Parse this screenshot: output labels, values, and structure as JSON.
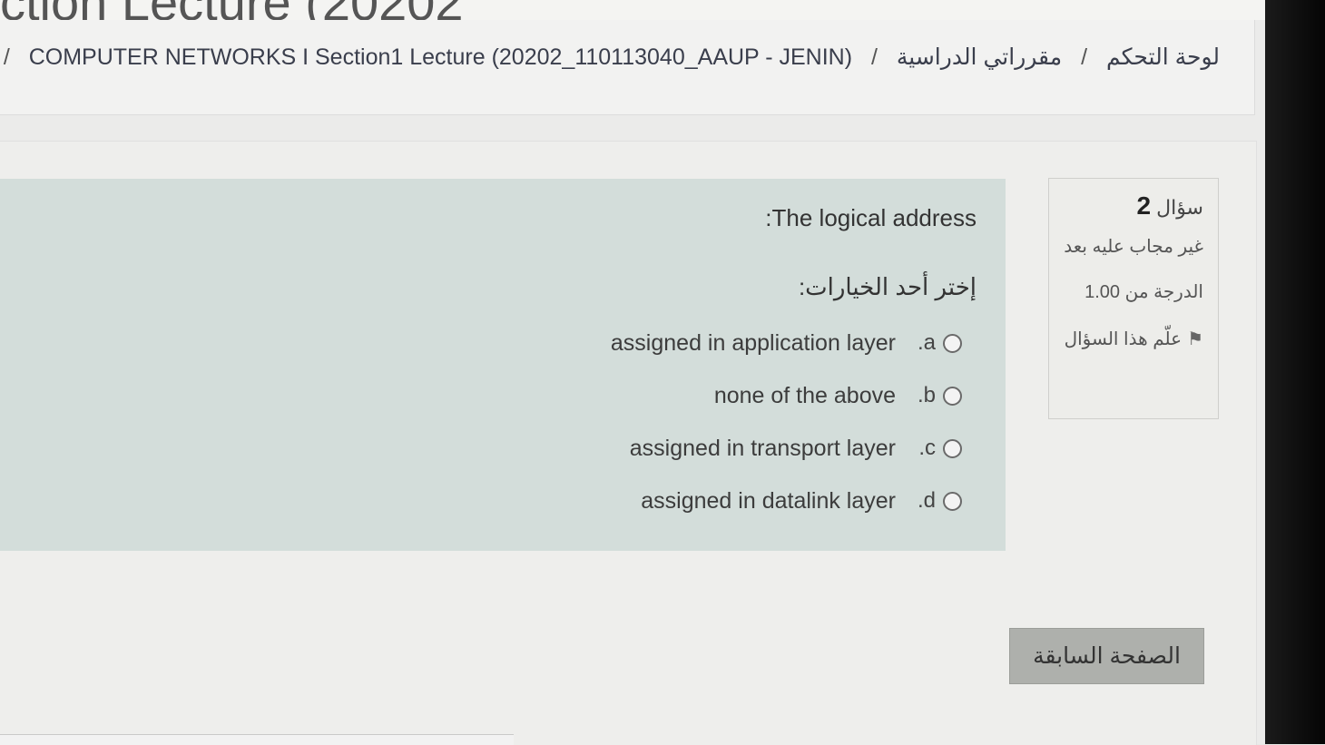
{
  "header": {
    "cut_title": "ction Lecture (20202"
  },
  "breadcrumb": {
    "items": [
      "لوحة التحكم",
      "مقرراتي الدراسية",
      "COMPUTER NETWORKS I Section1 Lecture (20202_110113040_AAUP - JENIN)"
    ],
    "separator": "/"
  },
  "question_info": {
    "label": "سؤال",
    "number": "2",
    "status": "غير مجاب عليه بعد",
    "grade": "الدرجة من 1.00",
    "flag_label": "علّم هذا السؤال",
    "flag_icon": "flag-icon"
  },
  "question": {
    "text": "The logical address:",
    "prompt": "إختر أحد الخيارات:",
    "options": [
      {
        "letter": "a.",
        "text": "assigned in application layer"
      },
      {
        "letter": "b.",
        "text": "none of the above"
      },
      {
        "letter": "c.",
        "text": "assigned in transport layer"
      },
      {
        "letter": "d.",
        "text": "assigned in datalink layer"
      }
    ]
  },
  "navigation": {
    "previous_label": "الصفحة السابقة"
  }
}
